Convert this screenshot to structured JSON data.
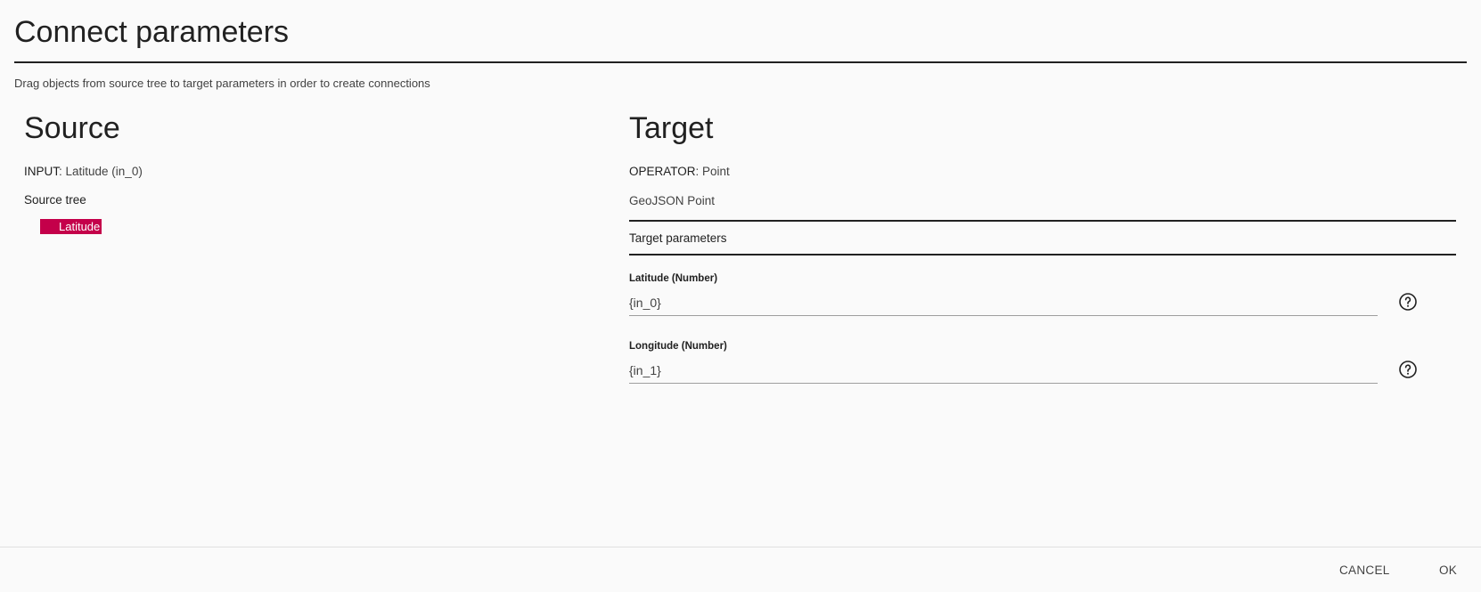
{
  "dialog": {
    "title": "Connect parameters",
    "subtitle": "Drag objects from source tree to target parameters in order to create connections"
  },
  "source": {
    "heading": "Source",
    "input_key": "INPUT",
    "input_value": ": Latitude (in_0)",
    "tree_label": "Source tree",
    "tree_items": [
      {
        "label": "Latitude"
      }
    ]
  },
  "target": {
    "heading": "Target",
    "operator_key": "OPERATOR",
    "operator_value": ": Point",
    "description": "GeoJSON Point",
    "params_heading": "Target parameters",
    "params": [
      {
        "label": "Latitude (Number)",
        "value": "{in_0}",
        "icon": "help-circle-icon"
      },
      {
        "label": "Longitude (Number)",
        "value": "{in_1}",
        "icon": "help-circle-icon"
      }
    ]
  },
  "footer": {
    "cancel_label": "CANCEL",
    "ok_label": "OK"
  },
  "colors": {
    "tree_highlight": "#c4004a",
    "background": "#fafafa",
    "text": "#212121"
  }
}
